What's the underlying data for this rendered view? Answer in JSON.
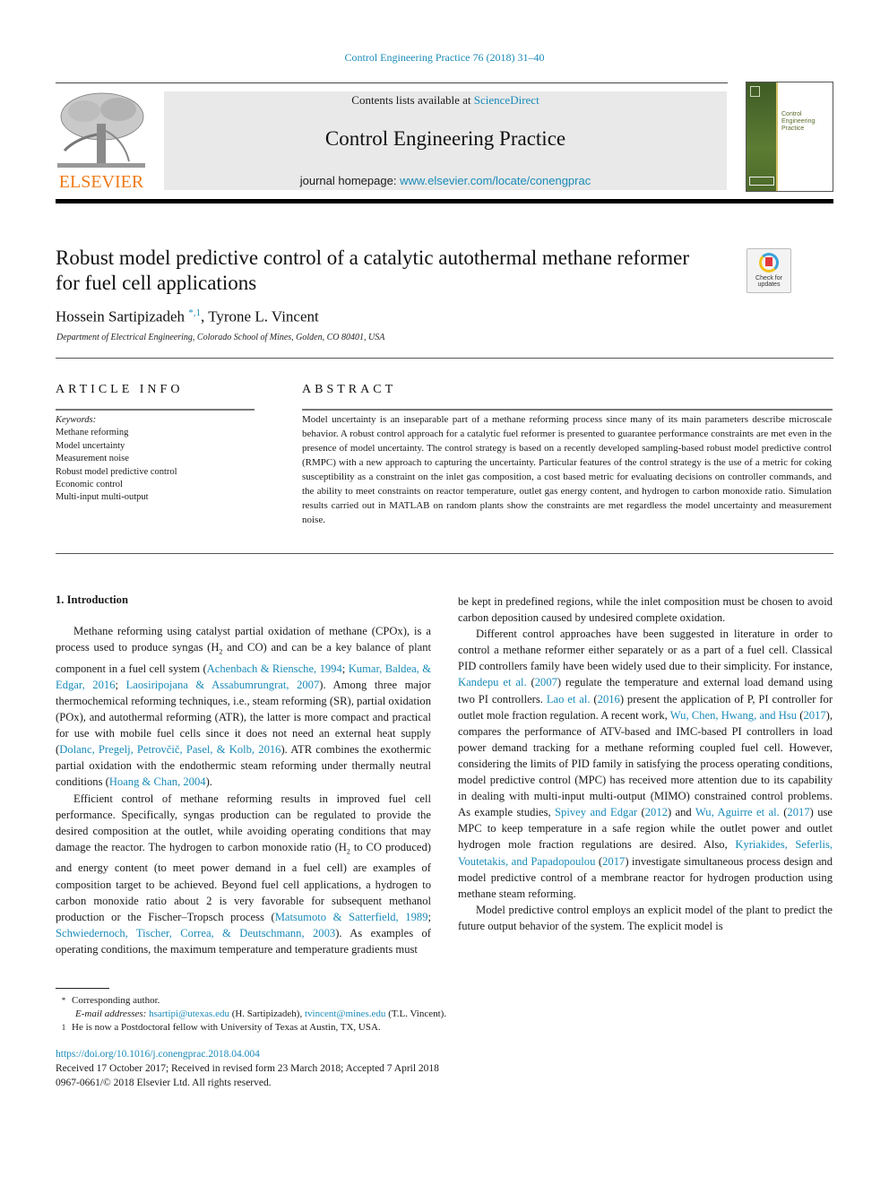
{
  "journal_ref": "Control Engineering Practice 76 (2018) 31–40",
  "masthead": {
    "publisher_logo_text": "ELSEVIER",
    "contents_prefix": "Contents lists available at ",
    "contents_link": "ScienceDirect",
    "journal_name": "Control Engineering Practice",
    "homepage_prefix": "journal homepage: ",
    "homepage_link": "www.elsevier.com/locate/conengprac",
    "cover_title_lines": [
      "Control",
      "Engineering",
      "Practice"
    ]
  },
  "crossmark": {
    "line1": "Check for",
    "line2": "updates"
  },
  "title": "Robust model predictive control of a catalytic autothermal methane reformer for fuel cell applications",
  "authors": [
    {
      "name": "Hossein Sartipizadeh",
      "marks": "*,1"
    },
    {
      "name": "Tyrone L. Vincent",
      "marks": ""
    }
  ],
  "author_separator": ", ",
  "affiliation": "Department of Electrical Engineering, Colorado School of Mines, Golden, CO 80401, USA",
  "article_info": {
    "heading": "ARTICLE INFO",
    "keywords_label": "Keywords:",
    "keywords": [
      "Methane reforming",
      "Model uncertainty",
      "Measurement noise",
      "Robust model predictive control",
      "Economic control",
      "Multi-input multi-output"
    ]
  },
  "abstract": {
    "heading": "ABSTRACT",
    "text": "Model uncertainty is an inseparable part of a methane reforming process since many of its main parameters describe microscale behavior. A robust control approach for a catalytic fuel reformer is presented to guarantee performance constraints are met even in the presence of model uncertainty. The control strategy is based on a recently developed sampling-based robust model predictive control (RMPC) with a new approach to capturing the uncertainty. Particular features of the control strategy is the use of a metric for coking susceptibility as a constraint on the inlet gas composition, a cost based metric for evaluating decisions on controller commands, and the ability to meet constraints on reactor temperature, outlet gas energy content, and hydrogen to carbon monoxide ratio. Simulation results carried out in MATLAB on random plants show the constraints are met regardless the model uncertainty and measurement noise."
  },
  "intro": {
    "heading": "1.  Introduction",
    "p1": [
      {
        "t": "Methane reforming using catalyst partial oxidation of methane (CPOx), is a process used to produce syngas (H"
      },
      {
        "sub": "2"
      },
      {
        "t": " and CO) and can be a key balance of plant component in a fuel cell system ("
      },
      {
        "link": "Achenbach & Riensche, 1994"
      },
      {
        "t": "; "
      },
      {
        "link": "Kumar, Baldea, & Edgar, 2016"
      },
      {
        "t": "; "
      },
      {
        "link": "Laosiripojana & Assabumrungrat, 2007"
      },
      {
        "t": "). Among three major thermochemical reforming techniques, i.e., steam reforming (SR), partial oxidation (POx), and autothermal reforming (ATR), the latter is more compact and practical for use with mobile fuel cells since it does not need an external heat supply ("
      },
      {
        "link": "Dolanc, Pregelj, Petrovčič, Pasel, & Kolb, 2016"
      },
      {
        "t": "). ATR combines the exothermic partial oxidation with the endothermic steam reforming under thermally neutral conditions ("
      },
      {
        "link": "Hoang & Chan, 2004"
      },
      {
        "t": ")."
      }
    ],
    "p2": [
      {
        "t": "Efficient control of methane reforming results in improved fuel cell performance. Specifically, syngas production can be regulated to provide the desired composition at the outlet, while avoiding operating conditions that may damage the reactor. The hydrogen to carbon monoxide ratio (H"
      },
      {
        "sub": "2"
      },
      {
        "t": " to CO produced) and energy content (to meet power demand in a fuel cell) are examples of composition target to be achieved. Beyond fuel cell applications, a hydrogen to carbon monoxide ratio about 2 is very favorable for subsequent methanol production or the Fischer–Tropsch process ("
      },
      {
        "link": "Matsumoto & Satterfield, 1989"
      },
      {
        "t": "; "
      },
      {
        "link": "Schwieder­noch, Tischer, Correa, & Deutschmann, 2003"
      },
      {
        "t": "). As examples of operating conditions, the maximum temperature and temperature gradients must be kept in predefined regions, while the inlet composition must be cho­sen to avoid carbon deposition caused by undesired complete oxidation."
      }
    ],
    "p3": [
      {
        "t": "Different control approaches have been suggested in literature in order to control a methane reformer either separately or as a part of a fuel cell. Classical PID controllers family have been widely used due to their simplicity. For instance, "
      },
      {
        "link": "Kandepu et al."
      },
      {
        "t": " ("
      },
      {
        "link": "2007"
      },
      {
        "t": ") regulate the temperature and external load demand using two PI controllers. "
      },
      {
        "link": "Lao et al."
      },
      {
        "t": " ("
      },
      {
        "link": "2016"
      },
      {
        "t": ") present the application of P, PI controller for outlet mole fraction regulation. A recent work, "
      },
      {
        "link": "Wu, Chen, Hwang, and Hsu"
      },
      {
        "t": " ("
      },
      {
        "link": "2017"
      },
      {
        "t": "), compares the performance of ATV-based and IMC-based PI controllers in load power demand tracking for a methane reforming coupled fuel cell. However, considering the limits of PID family in satisfying the process operating conditions, model predictive control (MPC) has received more attention due to its capability in dealing with multi-input multi-output (MIMO) constrained control problems. As example studies, "
      },
      {
        "link": "Spivey and Edgar"
      },
      {
        "t": " ("
      },
      {
        "link": "2012"
      },
      {
        "t": ") and "
      },
      {
        "link": "Wu, Aguirre et al."
      },
      {
        "t": " ("
      },
      {
        "link": "2017"
      },
      {
        "t": ") use MPC to keep temperature in a safe region while the outlet power and outlet hydrogen mole fraction regulations are desired. Also, "
      },
      {
        "link": "Kyriakides, Seferlis, Voutetakis, and Papadopoulou"
      },
      {
        "t": " ("
      },
      {
        "link": "2017"
      },
      {
        "t": ") investigate simultaneous process design and model predictive control of a membrane reactor for hydrogen production using methane steam reforming."
      }
    ],
    "p4": [
      {
        "t": "Model predictive control employs an explicit model of the plant to predict the future output behavior of the system. The explicit model is"
      }
    ]
  },
  "footnotes": {
    "corr_mark": "*",
    "corr_text": "Corresponding author.",
    "email_label": "E-mail addresses:",
    "email1": "hsartipi@utexas.edu",
    "email1_owner": " (H. Sartipizadeh), ",
    "email2": "tvincent@mines.edu",
    "email2_owner": " (T.L. Vincent).",
    "fn1_mark": "1",
    "fn1_text": "He is now a Postdoctoral fellow with University of Texas at Austin, TX, USA."
  },
  "pubinfo": {
    "doi": "https://doi.org/10.1016/j.conengprac.2018.04.004",
    "history": "Received 17 October 2017; Received in revised form 23 March 2018; Accepted 7 April 2018",
    "copyright": "0967-0661/© 2018 Elsevier Ltd. All rights reserved."
  }
}
